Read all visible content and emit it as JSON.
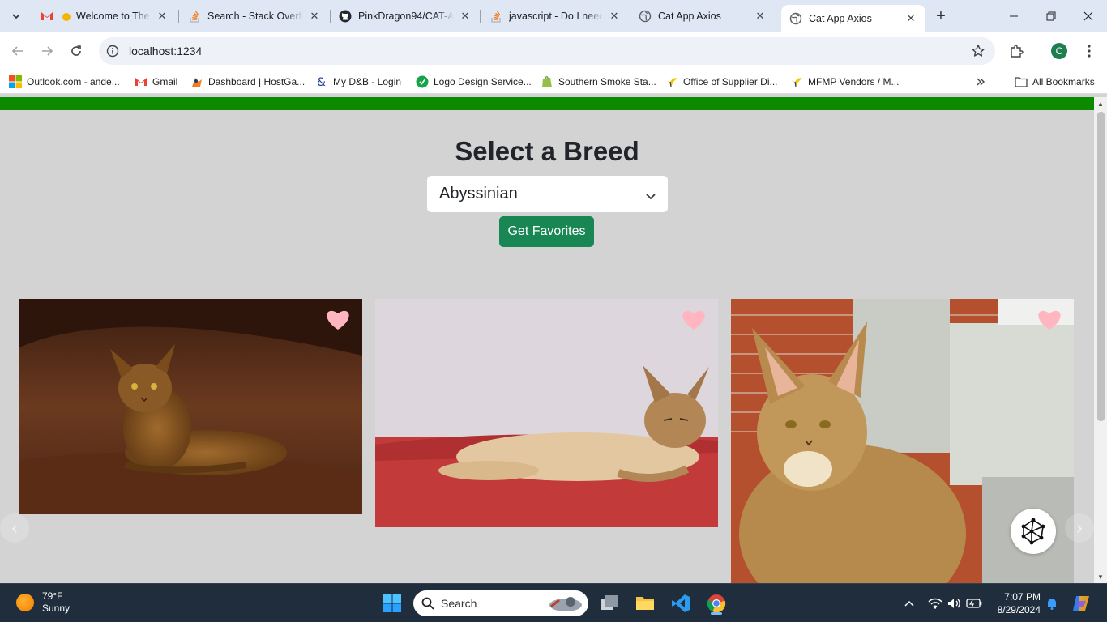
{
  "browser": {
    "tabs": [
      {
        "title": "Welcome to The C",
        "icon": "gmail-icon",
        "active": false
      },
      {
        "title": "Search - Stack Overflo",
        "icon": "stackoverflow-icon",
        "active": false
      },
      {
        "title": "PinkDragon94/CAT-A",
        "icon": "github-icon",
        "active": false
      },
      {
        "title": "javascript - Do I need",
        "icon": "stackoverflow-icon",
        "active": false
      },
      {
        "title": "Cat App Axios",
        "icon": "globe-icon",
        "active": false
      },
      {
        "title": "Cat App Axios",
        "icon": "globe-icon",
        "active": true
      }
    ],
    "address": "localhost:1234",
    "profile_initial": "C",
    "bookmarks": [
      {
        "label": "Outlook.com - ande...",
        "icon": "windows-icon"
      },
      {
        "label": "Gmail",
        "icon": "gmail-icon"
      },
      {
        "label": "Dashboard | HostGa...",
        "icon": "hostgator-icon"
      },
      {
        "label": "My D&B - Login",
        "icon": "dnb-icon"
      },
      {
        "label": "Logo Design Service...",
        "icon": "logo-design-icon"
      },
      {
        "label": "Southern Smoke Sta...",
        "icon": "shopify-icon"
      },
      {
        "label": "Office of Supplier Di...",
        "icon": "bird-logo-icon"
      },
      {
        "label": "MFMP Vendors / M...",
        "icon": "bird-logo-icon"
      }
    ],
    "all_bookmarks": "All Bookmarks"
  },
  "page": {
    "title": "Select a Breed",
    "selected_breed": "Abyssinian",
    "favorites_button": "Get Favorites",
    "cards": [
      {
        "alt": "Abyssinian cat lying on brown leather sofa",
        "favorited": true
      },
      {
        "alt": "Abyssinian cat resting on red surface",
        "favorited": true
      },
      {
        "alt": "Abyssinian cat sitting in front of brick building",
        "favorited": true
      }
    ],
    "colors": {
      "accent_green": "#198754",
      "top_bar": "#0b8a00",
      "heart": "#ffb6c1",
      "background": "#d3d3d3"
    }
  },
  "taskbar": {
    "temperature": "79°F",
    "weather": "Sunny",
    "search_placeholder": "Search",
    "time": "7:07 PM",
    "date": "8/29/2024"
  }
}
